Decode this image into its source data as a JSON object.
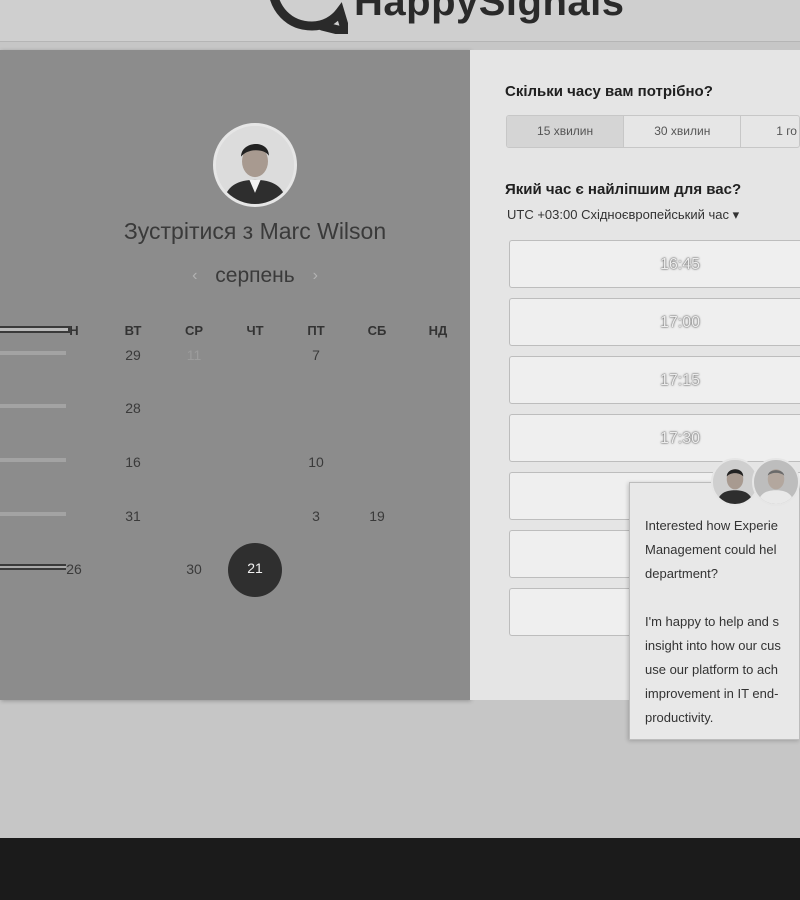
{
  "header": {
    "logo_text": "HappySignals"
  },
  "scheduler": {
    "title": "Зустрітися з Marc Wilson",
    "month": "серпень",
    "prev_arrow": "‹",
    "next_arrow": "›",
    "weekdays": [
      "Н",
      "ВТ",
      "СР",
      "ЧТ",
      "ПТ",
      "СБ",
      "НД"
    ],
    "rows": [
      [
        "",
        "29",
        "11",
        "",
        "7",
        "",
        ""
      ],
      [
        "",
        "28",
        "",
        "",
        "",
        "",
        ""
      ],
      [
        "",
        "16",
        "",
        "",
        "10",
        "",
        ""
      ],
      [
        "",
        "31",
        "",
        "",
        "3",
        "19",
        ""
      ],
      [
        "26",
        "",
        "30",
        "21",
        "",
        "",
        ""
      ]
    ],
    "selected_day": "21"
  },
  "duration": {
    "label": "Скільки часу вам потрібно?",
    "options": [
      "15 хвилин",
      "30 хвилин",
      "1 го"
    ],
    "selected": "15 хвилин"
  },
  "time": {
    "label": "Який час є найліпшим для вас?",
    "timezone": "UTC +03:00 Східноєвропейський час",
    "timezone_arrow": "▾",
    "slots": [
      "16:45",
      "17:00",
      "17:15",
      "17:30",
      "",
      "",
      ""
    ]
  },
  "chat": {
    "message": "Interested how Experie\nManagement could hel\ndepartment?\n\nI'm happy to help and s\ninsight into how our cus\nuse our platform to ach\nimprovement in IT end-\nproductivity."
  }
}
